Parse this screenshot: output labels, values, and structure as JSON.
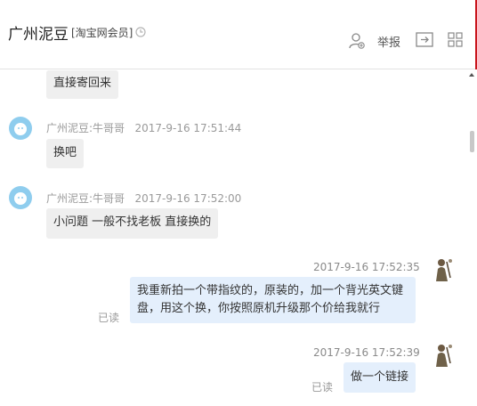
{
  "header": {
    "title": "广州泥豆",
    "badge": "[淘宝网会员]",
    "report_label": "举报"
  },
  "messages": [
    {
      "direction": "in",
      "text": "直接寄回来"
    },
    {
      "direction": "in",
      "sender": "广州泥豆:牛哥哥",
      "time": "2017-9-16 17:51:44",
      "text": "换吧"
    },
    {
      "direction": "in",
      "sender": "广州泥豆:牛哥哥",
      "time": "2017-9-16 17:52:00",
      "text": "小问题 一般不找老板 直接换的"
    },
    {
      "direction": "out",
      "time": "2017-9-16 17:52:35",
      "line1": "我重新拍一个带指纹的，原装的，加一个背光英文键",
      "line2": "盘，用这个换，你按照原机升级那个价给我就行",
      "read": "已读"
    },
    {
      "direction": "out",
      "time": "2017-9-16 17:52:39",
      "text": "做一个链接",
      "read": "已读"
    }
  ],
  "colors": {
    "accent_red": "#c8161d",
    "incoming_bubble": "#efefef",
    "outgoing_bubble": "#e4effc",
    "avatar_blue": "#8fcdee"
  },
  "icons": [
    "clock-icon",
    "add-contact-icon",
    "transfer-icon",
    "grid-apps-icon",
    "scroll-up-arrow-icon"
  ]
}
